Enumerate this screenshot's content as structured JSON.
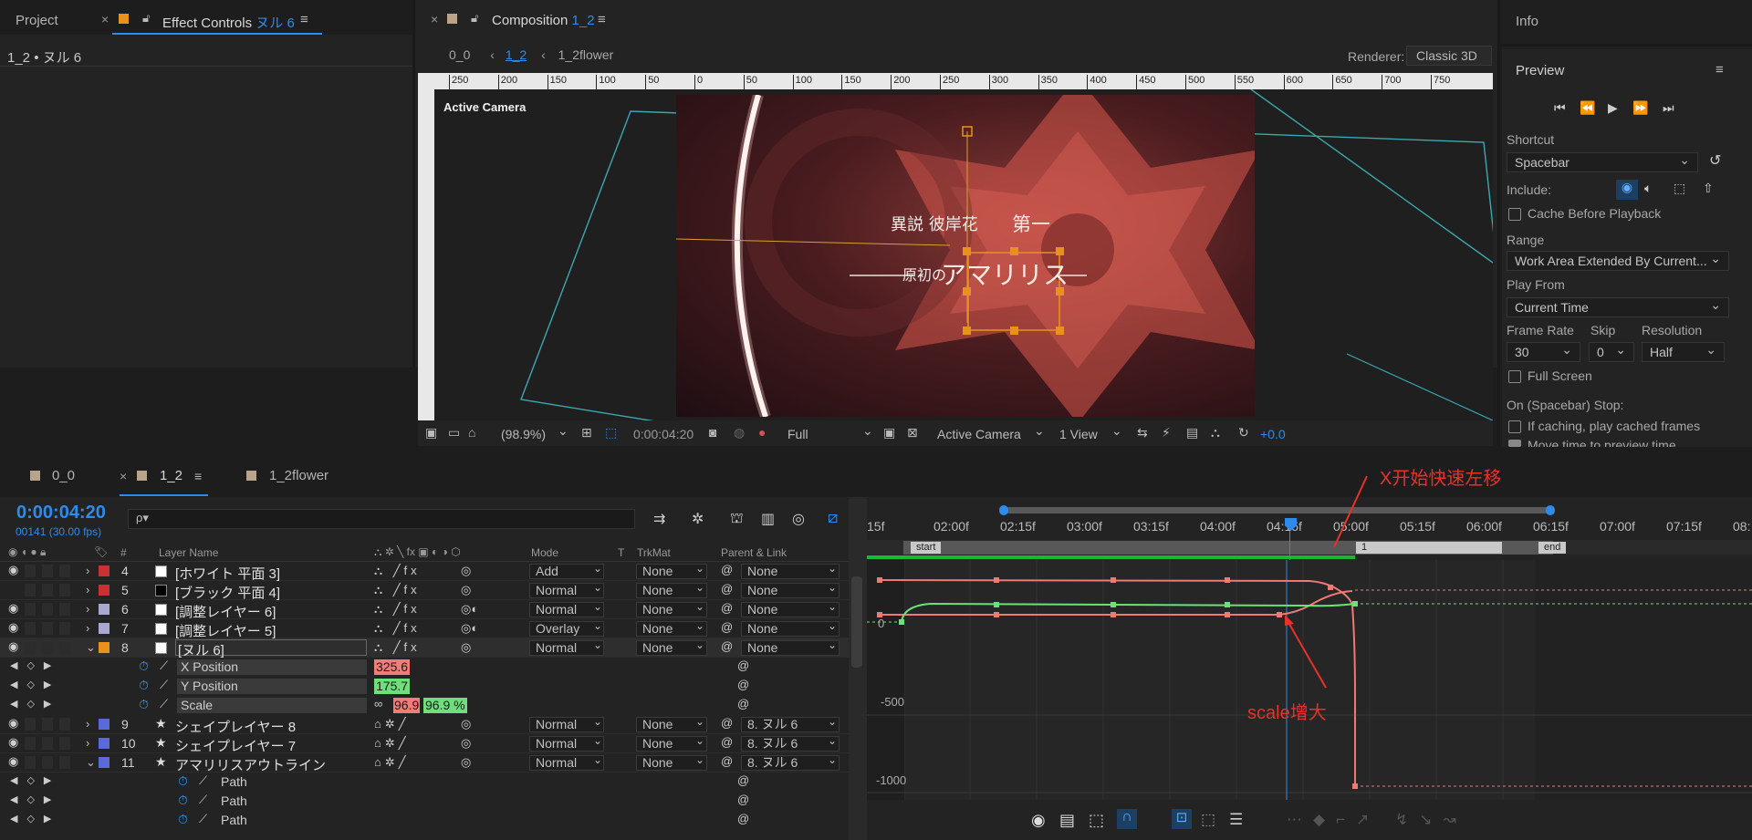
{
  "panels": {
    "project_tab": "Project",
    "effect_controls_tab": "Effect Controls",
    "effect_controls_layer": "ヌル 6",
    "effect_controls_path": "1_2 • ヌル 6",
    "composition_tab": "Composition",
    "composition_name": "1_2",
    "info_tab": "Info"
  },
  "comp": {
    "breadcrumbs": [
      "0_0",
      "1_2",
      "1_2flower"
    ],
    "renderer_label": "Renderer:",
    "renderer_value": "Classic 3D",
    "ruler_ticks": [
      "250",
      "200",
      "150",
      "100",
      "50",
      "0",
      "50",
      "100",
      "150",
      "200",
      "250",
      "300",
      "350",
      "400",
      "450",
      "500",
      "550",
      "600",
      "650",
      "700",
      "750"
    ],
    "active_camera_label": "Active Camera",
    "overlay_title_1": "異説 彼岸花",
    "overlay_title_2": "第一",
    "overlay_subtitle_1": "原初の",
    "overlay_subtitle_2": "アマリリス",
    "zoom": "(98.9%)",
    "timecode": "0:00:04:20",
    "resolution": "Full",
    "camera": "Active Camera",
    "views": "1 View",
    "exposure": "+0.0"
  },
  "preview": {
    "title": "Preview",
    "shortcut_label": "Shortcut",
    "shortcut_value": "Spacebar",
    "include_label": "Include:",
    "cache_label": "Cache Before Playback",
    "range_label": "Range",
    "range_value": "Work Area Extended By Current...",
    "play_from_label": "Play From",
    "play_from_value": "Current Time",
    "frame_rate_label": "Frame Rate",
    "frame_rate_value": "30",
    "skip_label": "Skip",
    "skip_value": "0",
    "resolution_label": "Resolution",
    "resolution_value": "Half",
    "full_screen_label": "Full Screen",
    "stop_label": "On (Spacebar) Stop:",
    "if_caching_label": "If caching, play cached frames",
    "move_time_label": "Move time to preview time"
  },
  "timeline": {
    "tabs": [
      "0_0",
      "1_2",
      "1_2flower"
    ],
    "timecode": "0:00:04:20",
    "frame_info": "00141 (30.00 fps)",
    "search_placeholder": "ρ▾",
    "headers": {
      "num": "#",
      "layer_name": "Layer Name",
      "mode": "Mode",
      "t": "T",
      "trkmat": "TrkMat",
      "parent": "Parent & Link"
    },
    "layers": [
      {
        "num": "4",
        "name": "[ホワイト 平面 3]",
        "color": "#c83232",
        "mode": "Add",
        "trkmat": "None",
        "parent": "None",
        "eye": true
      },
      {
        "num": "5",
        "name": "[ブラック 平面 4]",
        "color": "#c83232",
        "mode": "Normal",
        "trkmat": "None",
        "parent": "None",
        "eye": false
      },
      {
        "num": "6",
        "name": "[調整レイヤー 6]",
        "color": "#a8a8d0",
        "mode": "Normal",
        "trkmat": "None",
        "parent": "None",
        "eye": true
      },
      {
        "num": "7",
        "name": "[調整レイヤー 5]",
        "color": "#a8a8d0",
        "mode": "Overlay",
        "trkmat": "None",
        "parent": "None",
        "eye": true
      },
      {
        "num": "8",
        "name": "[ヌル 6]",
        "color": "#e8921c",
        "mode": "Normal",
        "trkmat": "None",
        "parent": "None",
        "eye": true
      }
    ],
    "props": [
      {
        "name": "X Position",
        "value": "325.6"
      },
      {
        "name": "Y Position",
        "value": "175.7"
      },
      {
        "name": "Scale",
        "value_x": "96.9",
        "value_y": "96.9 %"
      }
    ],
    "layers2": [
      {
        "num": "9",
        "name": "シェイプレイヤー 8",
        "color": "#5a6ad8",
        "mode": "Normal",
        "trkmat": "None",
        "parent": "8. ヌル 6"
      },
      {
        "num": "10",
        "name": "シェイプレイヤー 7",
        "color": "#5a6ad8",
        "mode": "Normal",
        "trkmat": "None",
        "parent": "8. ヌル 6"
      },
      {
        "num": "11",
        "name": "アマリリスアウトライン",
        "color": "#5a6ad8",
        "mode": "Normal",
        "trkmat": "None",
        "parent": "8. ヌル 6"
      }
    ],
    "paths": [
      "Path",
      "Path",
      "Path"
    ],
    "time_ruler": [
      "15f",
      "02:00f",
      "02:15f",
      "03:00f",
      "03:15f",
      "04:00f",
      "04:15f",
      "05:00f",
      "05:15f",
      "06:00f",
      "06:15f",
      "07:00f",
      "07:15f",
      "08:"
    ],
    "markers": {
      "start": "start",
      "one": "1",
      "end": "end"
    },
    "graph_labels": [
      "0",
      "-500",
      "-1000"
    ],
    "annotation_x": "X开始快速左移",
    "annotation_scale": "scale增大",
    "annotation_color": "#e8312a"
  }
}
